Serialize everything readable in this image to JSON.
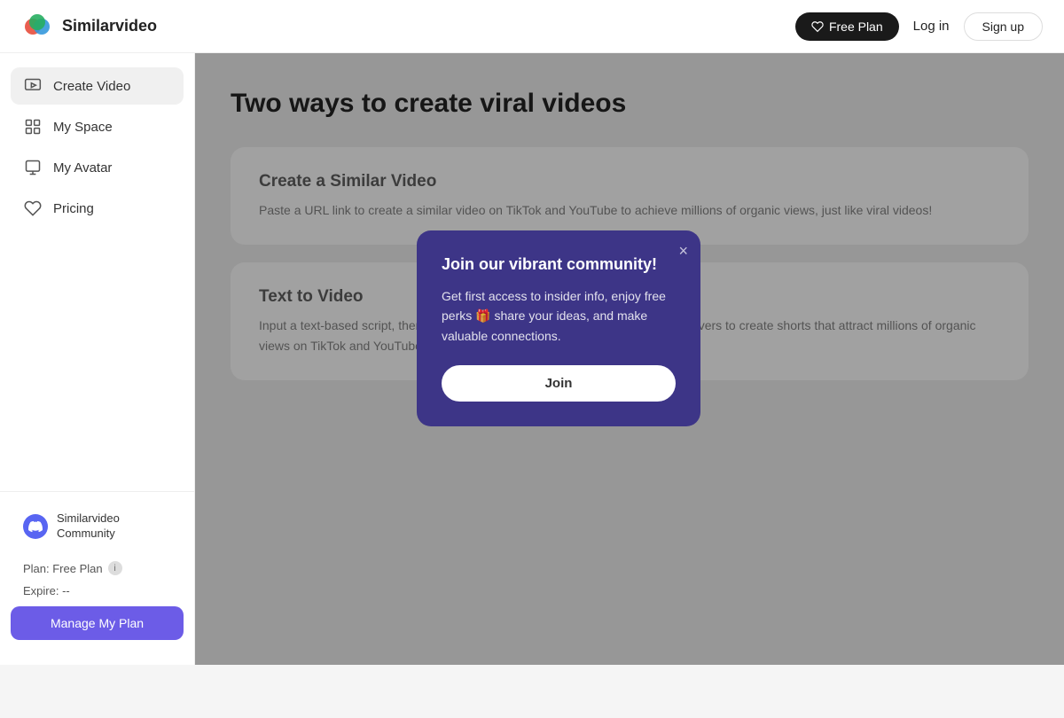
{
  "header": {
    "logo_name": "Similarvideo",
    "free_plan_label": "Free Plan",
    "login_label": "Log in",
    "signup_label": "Sign up"
  },
  "sidebar": {
    "nav_items": [
      {
        "id": "create-video",
        "label": "Create Video",
        "active": true
      },
      {
        "id": "my-space",
        "label": "My Space",
        "active": false
      },
      {
        "id": "my-avatar",
        "label": "My Avatar",
        "active": false
      },
      {
        "id": "pricing",
        "label": "Pricing",
        "active": false
      }
    ],
    "community": {
      "label": "Similarvideo Community"
    },
    "plan": {
      "label": "Plan: Free Plan",
      "expire_label": "Expire: --",
      "manage_btn": "Manage My Plan"
    }
  },
  "main": {
    "title": "Two ways to create viral videos",
    "cards": [
      {
        "id": "similar-video",
        "title": "Create a Similar Video",
        "description": "Paste a URL link to create a similar video on TikTok and YouTube to achieve millions of organic views, just like viral videos!"
      },
      {
        "id": "text-to-video",
        "title": "Text to Video",
        "description": "Input a text-based script, then generate videos with celebrity stickers and voiceovers to create shorts that attract millions of organic views on TikTok and YouTube 10x faster."
      }
    ]
  },
  "modal": {
    "title": "Join our vibrant community!",
    "description": "Get first access to insider info, enjoy free perks 🎁 share your ideas, and make valuable connections.",
    "join_btn": "Join",
    "close_label": "×"
  }
}
